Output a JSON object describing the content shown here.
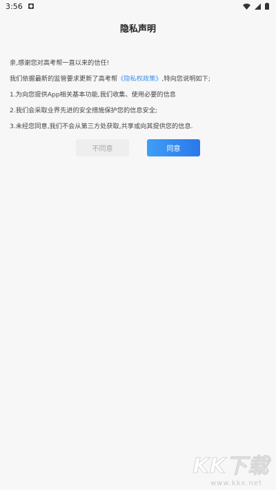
{
  "status_bar": {
    "time": "3:56"
  },
  "dialog": {
    "title": "隐私声明",
    "lines": {
      "greeting": "亲,感谢您对高考帮一直以来的信任!",
      "update_prefix": "我们依据最新的监管要求更新了高考帮",
      "policy_link": "《隐私权政策》",
      "update_suffix": ",特向您说明如下;",
      "item1": "1.为向您提供App相关基本功能,我们收集、使用必要的信息",
      "item2": "2.我们会采取业界先进的安全措施保护您的信息安全;",
      "item3": "3.未经您同意,我们不会从第三方处获取,共享或向其提供您的信息."
    },
    "buttons": {
      "disagree": "不同意",
      "agree": "同意"
    }
  },
  "watermark": {
    "logo": "KK下载",
    "url": "www.kkx.net"
  },
  "colors": {
    "link": "#3d8fe8",
    "agree_button": "#2f86ee",
    "disagree_button": "#eeeeee",
    "background": "#f7f7f8"
  }
}
